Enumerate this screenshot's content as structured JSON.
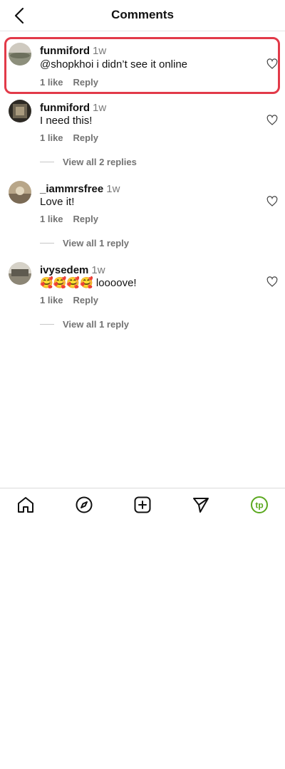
{
  "header": {
    "title": "Comments"
  },
  "comments": [
    {
      "username": "funmiford",
      "time": "1w",
      "text": "@shopkhoi i didn’t see it online",
      "likes": "1 like",
      "reply": "Reply"
    },
    {
      "username": "funmiford",
      "time": "1w",
      "text": "I need this!",
      "likes": "1 like",
      "reply": "Reply",
      "replies_label": "View all 2 replies"
    },
    {
      "username": "_iammrsfree",
      "time": "1w",
      "text": "Love it! ",
      "likes": "1 like",
      "reply": "Reply",
      "replies_label": "View all 1 reply"
    },
    {
      "username": "ivysedem",
      "time": "1w",
      "text": "🥰🥰🥰🥰 loooove!",
      "likes": "1 like",
      "reply": "Reply",
      "replies_label": "View all 1 reply"
    }
  ],
  "colors": {
    "highlight": "#e23a49",
    "profile_accent": "#5aa81e"
  },
  "nav_icons": [
    "home-icon",
    "compass-icon",
    "plus-square-icon",
    "send-icon",
    "profile-icon"
  ],
  "profile_initials": "tp"
}
